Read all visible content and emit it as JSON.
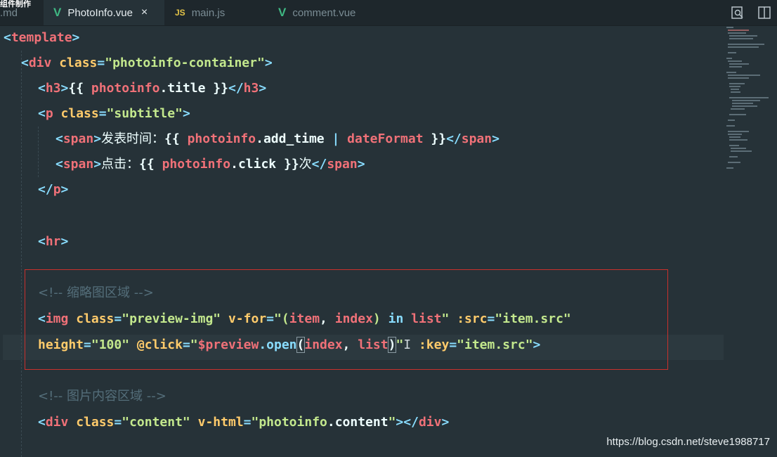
{
  "window": {
    "title": "组件制作"
  },
  "tabs": [
    {
      "label": ".md",
      "icon": "",
      "active": false
    },
    {
      "label": "PhotoInfo.vue",
      "icon": "vue-icon",
      "active": true
    },
    {
      "label": "main.js",
      "icon": "js-icon",
      "active": false
    },
    {
      "label": "comment.vue",
      "icon": "vue-icon",
      "active": false
    }
  ],
  "tab_icons": {
    "vue": "V",
    "js": "JS",
    "close": "×"
  },
  "toolbar": {
    "icons": [
      "search-preview-icon",
      "split-editor-icon"
    ]
  },
  "code": {
    "l1": {
      "open": "<",
      "tag": "template",
      "close": ">"
    },
    "l2": {
      "open": "<",
      "tag": "div",
      "attr": "class",
      "eq": "=",
      "val": "\"photoinfo-container\"",
      "close": ">"
    },
    "l3": {
      "open": "<",
      "tag": "h3",
      "close": ">",
      "m_open": "{{ ",
      "var": "photoinfo",
      "prop": ".title",
      "m_close": " }}",
      "end_open": "</",
      "end_tag": "h3",
      "end_close": ">"
    },
    "l4": {
      "open": "<",
      "tag": "p",
      "attr": "class",
      "eq": "=",
      "val": "\"subtitle\"",
      "close": ">"
    },
    "l5": {
      "open": "<",
      "tag": "span",
      "close": ">",
      "text": "发表时间：",
      "m_open": "{{ ",
      "var": "photoinfo",
      "prop": ".add_time",
      "pipe": " | ",
      "filter": "dateFormat",
      "m_close": " }}",
      "end_open": "</",
      "end_tag": "span",
      "end_close": ">"
    },
    "l6": {
      "open": "<",
      "tag": "span",
      "close": ">",
      "text": "点击：",
      "m_open": "{{ ",
      "var": "photoinfo",
      "prop": ".click",
      "m_close": " }}",
      "text2": "次",
      "end_open": "</",
      "end_tag": "span",
      "end_close": ">"
    },
    "l7": {
      "open": "</",
      "tag": "p",
      "close": ">"
    },
    "l8": {
      "open": "<",
      "tag": "hr",
      "close": ">"
    },
    "l9": {
      "comment": "<!-- 缩略图区域 -->"
    },
    "l10": {
      "open": "<",
      "tag": "img",
      "attr1": "class",
      "val1": "\"preview-img\"",
      "attr2": "v-for",
      "q_open": "\"(",
      "p1": "item",
      "comma": ", ",
      "p2": "index",
      "q_mid": ") ",
      "kw": "in",
      "sp": " ",
      "p3": "list",
      "q_close": "\"",
      "attr3": ":src",
      "val3": "\"item.src\"",
      "eq": "="
    },
    "l11": {
      "attr1": "height",
      "val1": "\"100\"",
      "attr2": "@click",
      "q_open": "\"",
      "dollar": "$preview",
      "method": ".open",
      "paren_open": "(",
      "a1": "index",
      "comma": ", ",
      "a2": "list",
      "paren_close": ")",
      "q_close": "\"",
      "attr3": ":key",
      "val3": "\"item.src\"",
      "close": ">",
      "eq": "="
    },
    "l12": {
      "comment": "<!-- 图片内容区域 -->"
    },
    "l13": {
      "open": "<",
      "tag": "div",
      "attr1": "class",
      "val1": "\"content\"",
      "attr2": "v-html",
      "val2": "\"photoinfo",
      "prop": ".content",
      "val2_end": "\"",
      "close": ">",
      "end_open": "</",
      "end_tag": "div",
      "end_close": ">",
      "eq": "="
    }
  },
  "colors": {
    "background": "#263238",
    "tag": "#f07178",
    "attribute": "#ffcb6b",
    "string": "#c3e88d",
    "highlight_box": "#c9302c"
  },
  "watermark": "https://blog.csdn.net/steve1988717"
}
